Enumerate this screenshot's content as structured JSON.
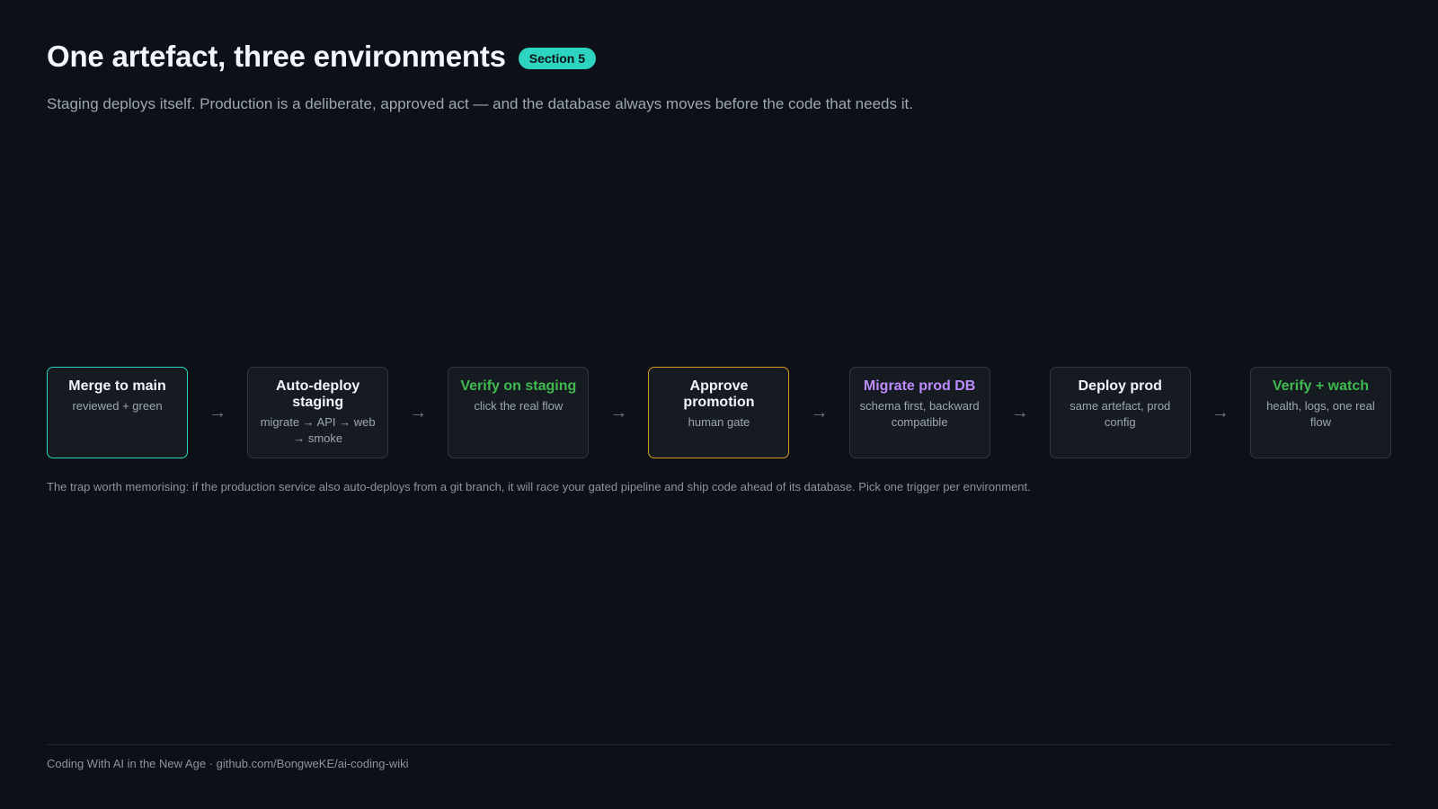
{
  "title": "One artefact, three environments",
  "badge": "Section 5",
  "subtitle": "Staging deploys itself. Production is a deliberate, approved act — and the database always moves before the code that needs it.",
  "flow": {
    "arrow": "→",
    "steps": [
      {
        "title": "Merge to main",
        "sub": "reviewed + green"
      },
      {
        "title": "Auto-deploy staging",
        "sub": "migrate → API → web → smoke"
      },
      {
        "title": "Verify on staging",
        "sub": "click the real flow"
      },
      {
        "title": "Approve promotion",
        "sub": "human gate"
      },
      {
        "title": "Migrate prod DB",
        "sub": "schema first, backward compatible"
      },
      {
        "title": "Deploy prod",
        "sub": "same artefact, prod config"
      },
      {
        "title": "Verify + watch",
        "sub": "health, logs, one real flow"
      }
    ]
  },
  "note": "The trap worth memorising: if the production service also auto-deploys from a git branch, it will race your gated pipeline and ship code ahead of its database. Pick one trigger per environment.",
  "footer": "Coding With AI in the New Age · github.com/BongweKE/ai-coding-wiki",
  "colors": {
    "background": "#0d1117",
    "accent_teal": "#2dd4bf",
    "accent_amber": "#d29922",
    "accent_green": "#3fb950",
    "accent_purple": "#bc8cff"
  }
}
